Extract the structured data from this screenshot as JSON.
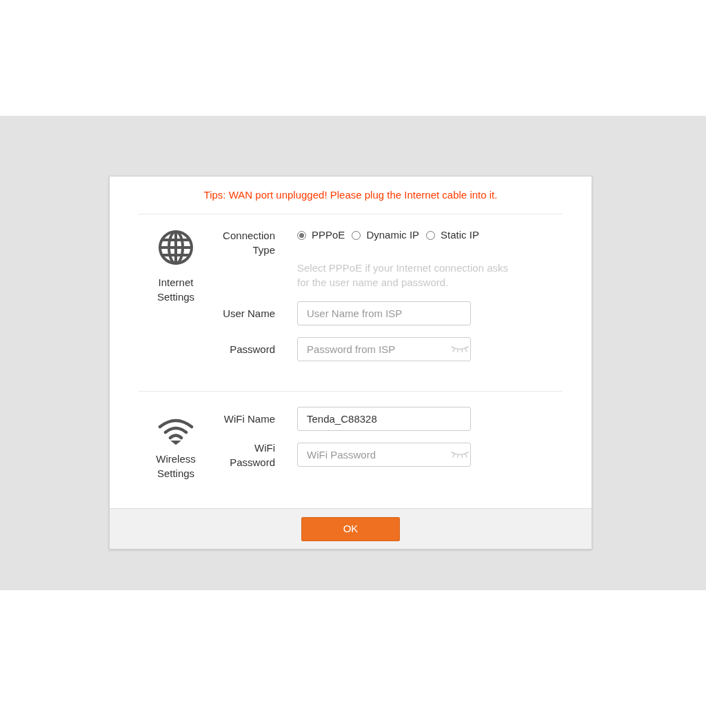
{
  "tip": "Tips: WAN port unplugged! Please plug the Internet cable into it.",
  "sections": [
    {
      "kind": "globe",
      "title": "Internet Settings",
      "fields": [
        {
          "kind": "radio",
          "label": "Connection Type",
          "options": [
            {
              "label": "PPPoE",
              "selected": true
            },
            {
              "label": "Dynamic IP",
              "selected": false
            },
            {
              "label": "Static IP",
              "selected": false
            }
          ],
          "help": "Select PPPoE if your Internet connection asks for the user name and password."
        },
        {
          "kind": "text",
          "label": "User Name",
          "placeholder": "User Name from ISP"
        },
        {
          "kind": "password",
          "label": "Password",
          "placeholder": "Password from ISP"
        }
      ]
    },
    {
      "kind": "wifi",
      "title": "Wireless Settings",
      "fields": [
        {
          "kind": "text",
          "label": "WiFi Name",
          "value": "Tenda_C88328"
        },
        {
          "kind": "password",
          "label": "WiFi Password",
          "placeholder": "WiFi Password"
        }
      ]
    }
  ],
  "ok_button": "OK"
}
